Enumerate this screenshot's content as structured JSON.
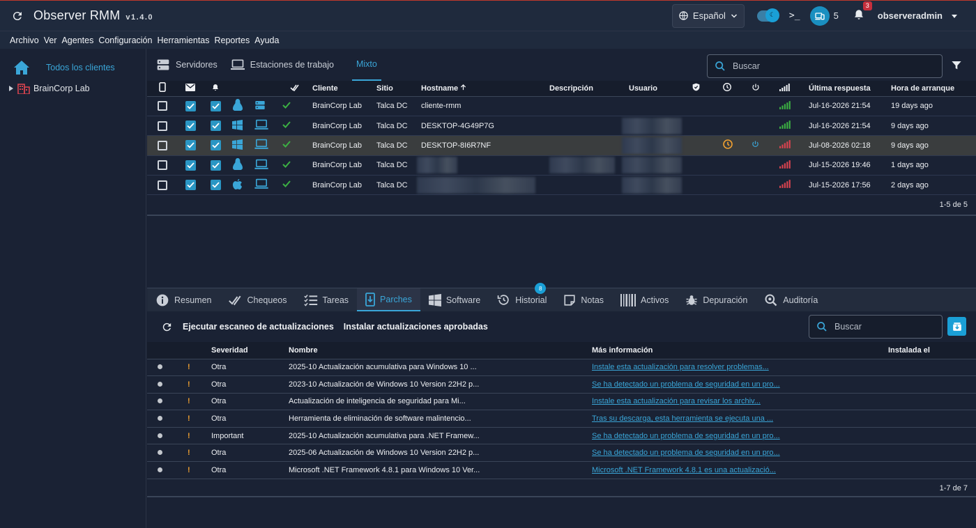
{
  "app": {
    "title": "Observer RMM",
    "version": "v1.4.0"
  },
  "header": {
    "language": "Español",
    "terminal_label": ">_",
    "devices_count": "5",
    "notifications_count": "3",
    "username": "observeradmin"
  },
  "menu": [
    "Archivo",
    "Ver",
    "Agentes",
    "Configuración",
    "Herramientas",
    "Reportes",
    "Ayuda"
  ],
  "tree": {
    "root": "Todos los clientes",
    "client": "BrainCorp Lab"
  },
  "agent_tabs": [
    "Servidores",
    "Estaciones de trabajo",
    "Mixto"
  ],
  "agent_search_placeholder": "Buscar",
  "agent_columns": {
    "cliente": "Cliente",
    "sitio": "Sitio",
    "hostname": "Hostname",
    "descripcion": "Descripción",
    "usuario": "Usuario",
    "ultima": "Última respuesta",
    "arranque": "Hora de arranque"
  },
  "agents": [
    {
      "os": "linux",
      "type": "server",
      "client": "BrainCorp Lab",
      "site": "Talca DC",
      "hostname": "cliente-rmm",
      "last": "Jul-16-2026 21:54",
      "boot": "19 days ago",
      "signal": "good",
      "selected": false
    },
    {
      "os": "windows",
      "type": "workstation",
      "client": "BrainCorp Lab",
      "site": "Talca DC",
      "hostname": "DESKTOP-4G49P7G",
      "last": "Jul-16-2026 21:54",
      "boot": "9 days ago",
      "signal": "good",
      "selected": false
    },
    {
      "os": "windows",
      "type": "workstation",
      "client": "BrainCorp Lab",
      "site": "Talca DC",
      "hostname": "DESKTOP-8I6R7NF",
      "last": "Jul-08-2026 02:18",
      "boot": "9 days ago",
      "signal": "bad",
      "selected": true
    },
    {
      "os": "linux",
      "type": "workstation",
      "client": "BrainCorp Lab",
      "site": "Talca DC",
      "hostname": "",
      "last": "Jul-15-2026 19:46",
      "boot": "1 days ago",
      "signal": "bad",
      "selected": false
    },
    {
      "os": "apple",
      "type": "workstation",
      "client": "BrainCorp Lab",
      "site": "Talca DC",
      "hostname": "",
      "last": "Jul-15-2026 17:56",
      "boot": "2 days ago",
      "signal": "bad",
      "selected": false
    }
  ],
  "agents_pagination": "1-5 de 5",
  "bottom_tabs": [
    "Resumen",
    "Chequeos",
    "Tareas",
    "Parches",
    "Software",
    "Historial",
    "Notas",
    "Activos",
    "Depuración",
    "Auditoría"
  ],
  "history_badge": "8",
  "patch_actions": {
    "scan": "Ejecutar escaneo de actualizaciones",
    "install": "Instalar actualizaciones aprobadas"
  },
  "patch_search_placeholder": "Buscar",
  "patch_columns": {
    "severity": "Severidad",
    "name": "Nombre",
    "more": "Más información",
    "installed": "Instalada el"
  },
  "patches": [
    {
      "severity": "Otra",
      "name": "2025-10 Actualización acumulativa para Windows 10 ...",
      "info": "Instale esta actualización para resolver problemas..."
    },
    {
      "severity": "Otra",
      "name": "2023-10 Actualización de Windows 10 Version 22H2 p...",
      "info": "Se ha detectado un problema de seguridad en un pro..."
    },
    {
      "severity": "Otra",
      "name": "Actualización de inteligencia de seguridad para Mi...",
      "info": "Instale esta actualización para revisar los archiv..."
    },
    {
      "severity": "Otra",
      "name": "Herramienta de eliminación de software malintencio...",
      "info": "Tras su descarga, esta herramienta se ejecuta una ..."
    },
    {
      "severity": "Important",
      "name": "2025-10 Actualización acumulativa para .NET Framew...",
      "info": "Se ha detectado un problema de seguridad en un pro..."
    },
    {
      "severity": "Otra",
      "name": "2025-06 Actualización de Windows 10 Version 22H2 p...",
      "info": "Se ha detectado un problema de seguridad en un pro..."
    },
    {
      "severity": "Otra",
      "name": "Microsoft .NET Framework 4.8.1 para Windows 10 Ver...",
      "info": "Microsoft .NET Framework 4.8.1 es una actualizació..."
    }
  ],
  "patch_pagination": "1-7 de 7",
  "colors": {
    "accent": "#3aa6d8",
    "checkbox": "#2a96c4",
    "warn": "#f0a030",
    "good": "#3cb043",
    "bad": "#d9434f"
  }
}
